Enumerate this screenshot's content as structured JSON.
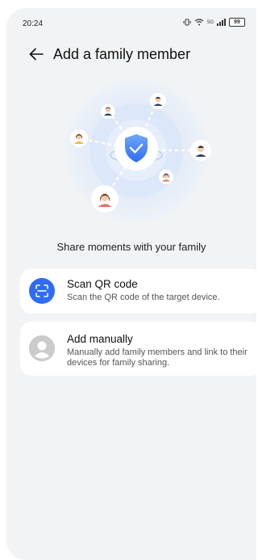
{
  "status_bar": {
    "time": "20:24",
    "network": "5G",
    "battery": "99"
  },
  "header": {
    "back_icon": "arrow-left-icon",
    "title": "Add a family member"
  },
  "illustration": {
    "center_icon": "shield-check-icon",
    "accent_color": "#3a86e8",
    "avatars": [
      "avatar-man",
      "avatar-man",
      "avatar-woman",
      "avatar-man",
      "avatar-woman",
      "avatar-woman"
    ]
  },
  "tagline": "Share moments with your family",
  "options": [
    {
      "icon": "scan-icon",
      "icon_color": "#2f6cf6",
      "title": "Scan QR code",
      "description": "Scan the QR code of the target device."
    },
    {
      "icon": "person-icon",
      "icon_color": "#c8c8c8",
      "title": "Add manually",
      "description": "Manually add family members and link to their devices for family sharing."
    }
  ]
}
